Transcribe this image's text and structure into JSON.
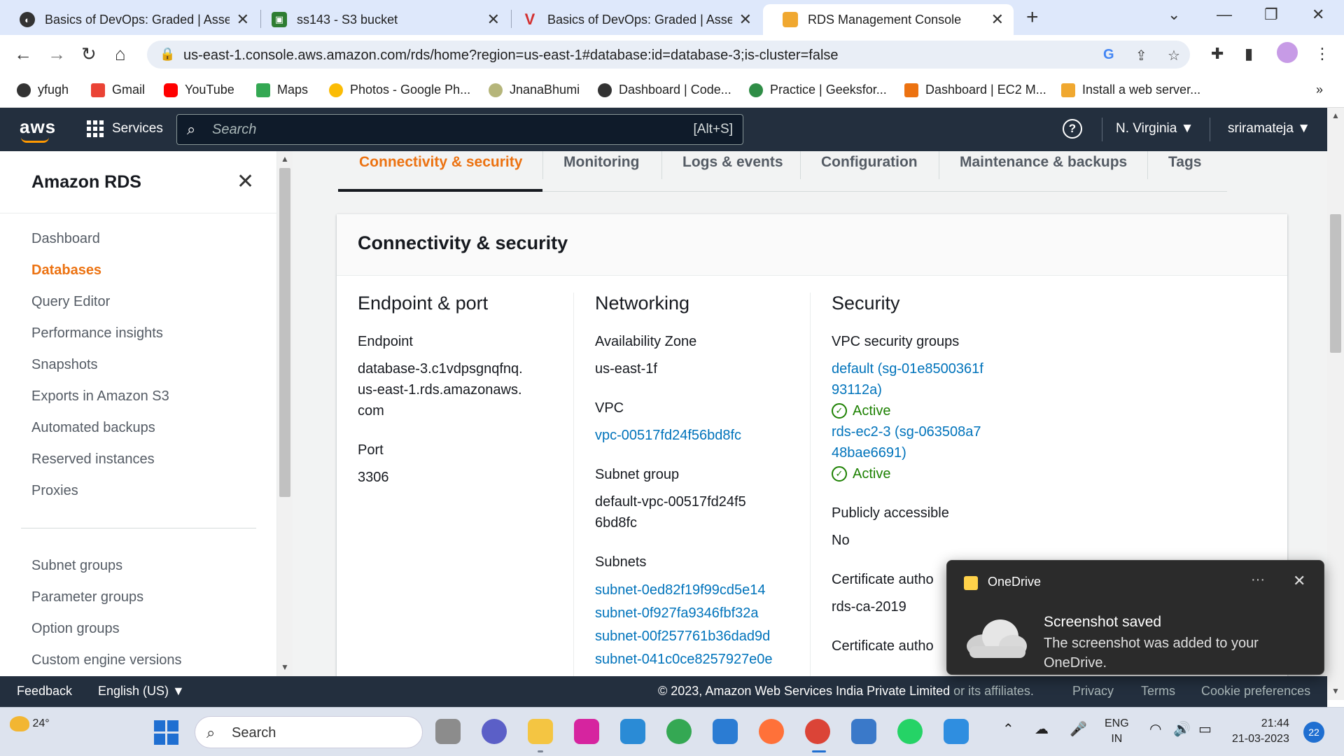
{
  "browser": {
    "tabs": [
      {
        "title": "Basics of DevOps: Graded | Asses",
        "active": false
      },
      {
        "title": "ss143 - S3 bucket",
        "active": false
      },
      {
        "title": "Basics of DevOps: Graded | Asses",
        "active": false
      },
      {
        "title": "RDS Management Console",
        "active": true
      }
    ],
    "url": "us-east-1.console.aws.amazon.com/rds/home?region=us-east-1#database:id=database-3;is-cluster=false",
    "bookmarks": [
      "yfugh",
      "Gmail",
      "YouTube",
      "Maps",
      "Photos - Google Ph...",
      "JnanaBhumi",
      "Dashboard | Code...",
      "Practice | Geeksfor...",
      "Dashboard | EC2 M...",
      "Install a web server..."
    ],
    "bookmarks_overflow": "»"
  },
  "aws_header": {
    "logo": "aws",
    "services_label": "Services",
    "search_placeholder": "Search",
    "search_shortcut": "[Alt+S]",
    "help": "?",
    "region": "N. Virginia ▼",
    "user": "sriramateja ▼"
  },
  "sidebar": {
    "title": "Amazon RDS",
    "close": "✕",
    "items_primary": [
      "Dashboard",
      "Databases",
      "Query Editor",
      "Performance insights",
      "Snapshots",
      "Exports in Amazon S3",
      "Automated backups",
      "Reserved instances",
      "Proxies"
    ],
    "active_item": "Databases",
    "items_secondary": [
      "Subnet groups",
      "Parameter groups",
      "Option groups",
      "Custom engine versions"
    ]
  },
  "content_tabs": {
    "items": [
      "Connectivity & security",
      "Monitoring",
      "Logs & events",
      "Configuration",
      "Maintenance & backups",
      "Tags"
    ],
    "active": "Connectivity & security"
  },
  "panel": {
    "title": "Connectivity & security",
    "endpoint_port": {
      "heading": "Endpoint & port",
      "endpoint_label": "Endpoint",
      "endpoint_value": "database-3.c1vdpsgnqfnq.us-east-1.rds.amazonaws.com",
      "port_label": "Port",
      "port_value": "3306"
    },
    "networking": {
      "heading": "Networking",
      "az_label": "Availability Zone",
      "az_value": "us-east-1f",
      "vpc_label": "VPC",
      "vpc_value": "vpc-00517fd24f56bd8fc",
      "subnet_group_label": "Subnet group",
      "subnet_group_value": "default-vpc-00517fd24f56bd8fc",
      "subnets_label": "Subnets",
      "subnets": [
        "subnet-0ed82f19f99cd5e14",
        "subnet-0f927fa9346fbf32a",
        "subnet-00f257761b36dad9d",
        "subnet-041c0ce8257927e0e"
      ]
    },
    "security": {
      "heading": "Security",
      "sg_label": "VPC security groups",
      "sg1": "default (sg-01e8500361f93112a)",
      "sg1_status": "Active",
      "sg2": "rds-ec2-3 (sg-063508a748bae6691)",
      "sg2_status": "Active",
      "public_label": "Publicly accessible",
      "public_value": "No",
      "cert_label": "Certificate autho",
      "cert_value": "rds-ca-2019",
      "cert_label2": "Certificate autho"
    }
  },
  "footer": {
    "feedback": "Feedback",
    "language": "English (US) ▼",
    "copyright": "© 2023, Amazon Web Services India Private Limited",
    "copyright_rest": "or its affiliates.",
    "privacy": "Privacy",
    "terms": "Terms",
    "cookies": "Cookie preferences"
  },
  "toast": {
    "app": "OneDrive",
    "more": "···",
    "close": "✕",
    "title": "Screenshot saved",
    "body": "The screenshot was added to your OneDrive."
  },
  "taskbar": {
    "temperature": "24°",
    "search_label": "Search",
    "lang_top": "ENG",
    "lang_bottom": "IN",
    "time": "21:44",
    "date": "21-03-2023",
    "notifications": "22"
  },
  "colors": {
    "aws_navy": "#232f3e",
    "aws_orange": "#ec7211",
    "link_blue": "#0073bb",
    "status_green": "#1d8102"
  }
}
